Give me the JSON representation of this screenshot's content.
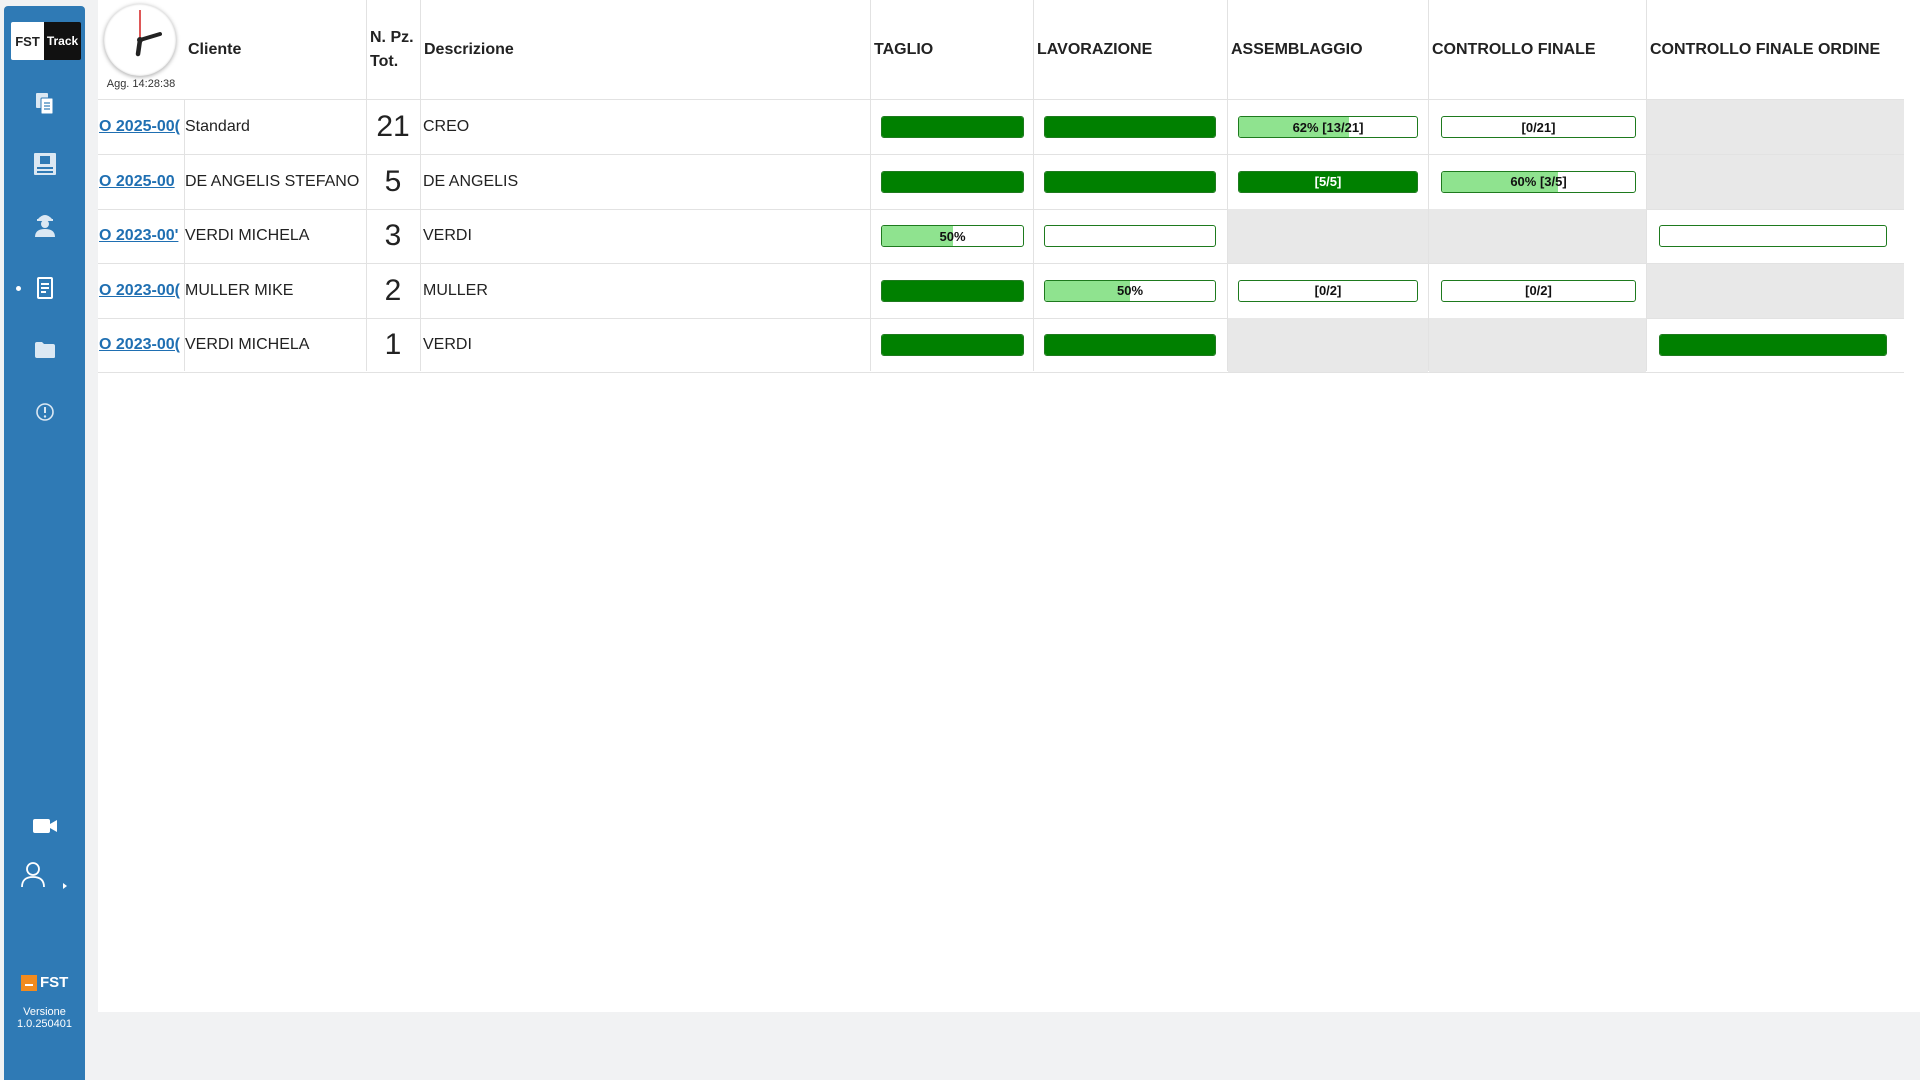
{
  "app": {
    "logo_left": "FST",
    "logo_right": "Track",
    "brand": "FST",
    "version_label": "Versione",
    "version_number": "1.0.250401"
  },
  "sidebar": {
    "items": [
      {
        "name": "documents-icon"
      },
      {
        "name": "warehouse-icon"
      },
      {
        "name": "worker-icon"
      },
      {
        "name": "list-icon",
        "active": true
      },
      {
        "name": "folder-icon"
      },
      {
        "name": "alert-icon"
      }
    ],
    "bottom_items": [
      {
        "name": "video-camera-icon"
      },
      {
        "name": "user-icon"
      }
    ]
  },
  "header": {
    "updated": "Agg. 14:28:38",
    "columns": {
      "cliente": "Cliente",
      "npz_line1": "N. Pz.",
      "npz_line2": "Tot.",
      "descrizione": "Descrizione",
      "taglio": "TAGLIO",
      "lavorazione": "LAVORAZIONE",
      "assemblaggio": "ASSEMBLAGGIO",
      "controllo_finale": "CONTROLLO FINALE",
      "controllo_finale_ordine": "CONTROLLO FINALE ORDINE"
    }
  },
  "colors": {
    "dark_green": "#008000",
    "light_green": "#8fe38f",
    "sidebar_blue": "#2f7ab5",
    "link_blue": "#1f6fb2",
    "na_grey": "#e8e8e8"
  },
  "rows": [
    {
      "order": "O 2025-00(",
      "cliente": "Standard",
      "qty": "21",
      "descrizione": "CREO",
      "taglio": {
        "na": false,
        "fill": 1,
        "label": ""
      },
      "lavorazione": {
        "na": false,
        "fill": 1,
        "label": ""
      },
      "assemblaggio": {
        "na": false,
        "fill": 0.62,
        "label": "62% [13/21]"
      },
      "controllo_finale": {
        "na": false,
        "fill": 0,
        "label": "[0/21]"
      },
      "controllo_finale_ordine": {
        "na": true
      }
    },
    {
      "order": "O 2025-00",
      "cliente": "DE ANGELIS STEFANO",
      "qty": "5",
      "descrizione": "DE ANGELIS",
      "taglio": {
        "na": false,
        "fill": 1,
        "label": ""
      },
      "lavorazione": {
        "na": false,
        "fill": 1,
        "label": ""
      },
      "assemblaggio": {
        "na": false,
        "fill": 1,
        "label": "[5/5]"
      },
      "controllo_finale": {
        "na": false,
        "fill": 0.6,
        "label": "60% [3/5]"
      },
      "controllo_finale_ordine": {
        "na": true
      }
    },
    {
      "order": "O 2023-00'",
      "cliente": "VERDI MICHELA",
      "qty": "3",
      "descrizione": "VERDI",
      "taglio": {
        "na": false,
        "fill": 0.5,
        "label": "50%"
      },
      "lavorazione": {
        "na": false,
        "fill": 0,
        "label": ""
      },
      "assemblaggio": {
        "na": true
      },
      "controllo_finale": {
        "na": true
      },
      "controllo_finale_ordine": {
        "na": false,
        "fill": 0,
        "label": ""
      }
    },
    {
      "order": "O 2023-00(",
      "cliente": "MULLER MIKE",
      "qty": "2",
      "descrizione": "MULLER",
      "taglio": {
        "na": false,
        "fill": 1,
        "label": ""
      },
      "lavorazione": {
        "na": false,
        "fill": 0.5,
        "label": "50%"
      },
      "assemblaggio": {
        "na": false,
        "fill": 0,
        "label": "[0/2]"
      },
      "controllo_finale": {
        "na": false,
        "fill": 0,
        "label": "[0/2]"
      },
      "controllo_finale_ordine": {
        "na": true
      }
    },
    {
      "order": "O 2023-00(",
      "cliente": "VERDI MICHELA",
      "qty": "1",
      "descrizione": "VERDI",
      "taglio": {
        "na": false,
        "fill": 1,
        "label": ""
      },
      "lavorazione": {
        "na": false,
        "fill": 1,
        "label": ""
      },
      "assemblaggio": {
        "na": true
      },
      "controllo_finale": {
        "na": true
      },
      "controllo_finale_ordine": {
        "na": false,
        "fill": 1,
        "label": ""
      }
    }
  ]
}
